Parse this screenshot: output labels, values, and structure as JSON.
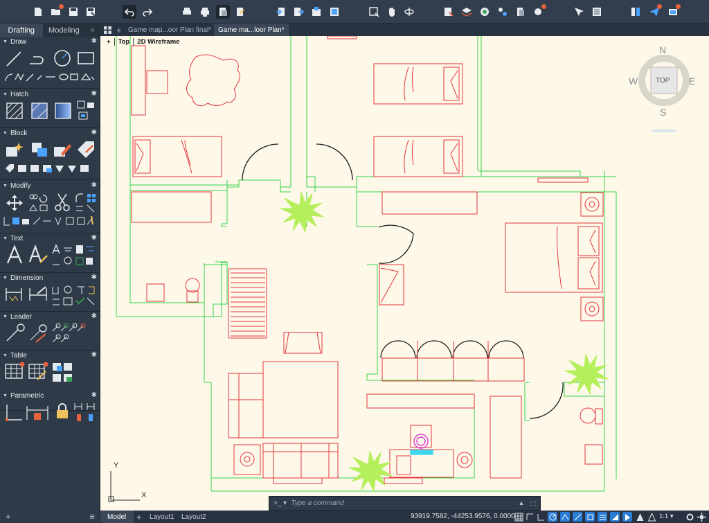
{
  "palette": {
    "tabs": [
      {
        "label": "Drafting"
      },
      {
        "label": "Modeling"
      }
    ],
    "collapse_glyph": "«",
    "sections": [
      {
        "title": "Draw"
      },
      {
        "title": "Hatch"
      },
      {
        "title": "Block"
      },
      {
        "title": "Modify"
      },
      {
        "title": "Text"
      },
      {
        "title": "Dimension"
      },
      {
        "title": "Leader"
      },
      {
        "title": "Table"
      },
      {
        "title": "Parametric"
      }
    ],
    "bottom": {
      "add_glyph": "+",
      "menu_glyph": "≡"
    }
  },
  "doc_tabs": [
    {
      "label": "Game map...oor Plan final*"
    },
    {
      "label": "Game ma...loor Plan*"
    }
  ],
  "viewport": {
    "view_label": "Top",
    "visual_style": "2D Wireframe",
    "plus": "+"
  },
  "viewcube": {
    "n": "N",
    "s": "S",
    "e": "E",
    "w": "W",
    "top": "TOP"
  },
  "ucs": {
    "x": "X",
    "y": "Y"
  },
  "command": {
    "prompt": ">_ ▾",
    "placeholder": "Type a command"
  },
  "layout_tabs": [
    {
      "label": "Model"
    },
    {
      "label": "Layout1"
    },
    {
      "label": "Layout2"
    }
  ],
  "status": {
    "coords": "93919.7582, -44253.9576, 0.0000",
    "scale": "1:1 ▾"
  },
  "colors": {
    "walls": "#34d34a",
    "furniture": "#e8333b",
    "plants": "#b5ef5c",
    "doors": "#1b1b1b",
    "magenta": "#e03ad9",
    "cyan": "#3ed7f0"
  }
}
